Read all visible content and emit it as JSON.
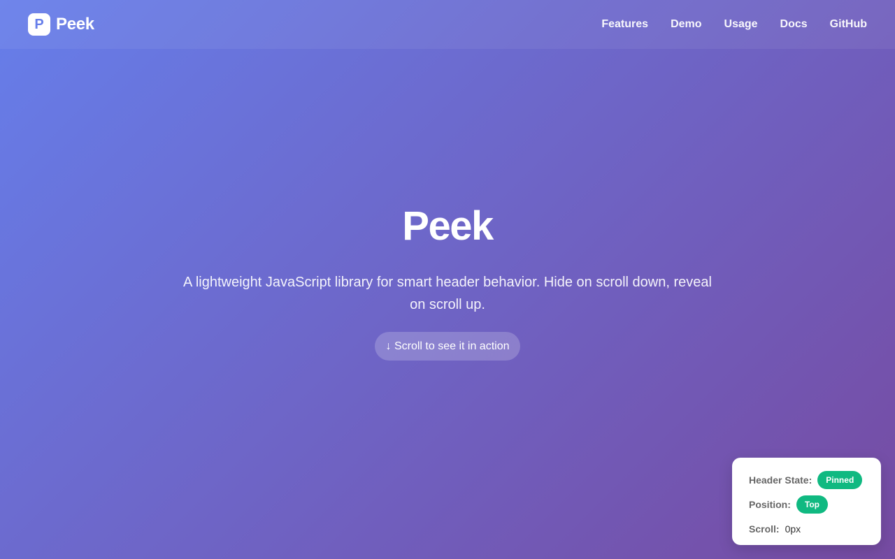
{
  "header": {
    "logo_letter": "P",
    "brand": "Peek",
    "nav": [
      {
        "label": "Features"
      },
      {
        "label": "Demo"
      },
      {
        "label": "Usage"
      },
      {
        "label": "Docs"
      },
      {
        "label": "GitHub"
      }
    ]
  },
  "hero": {
    "title": "Peek",
    "subtitle": "A lightweight JavaScript library for smart header behavior. Hide on scroll down, reveal on scroll up.",
    "cta": "↓ Scroll to see it in action"
  },
  "status": {
    "header_state_label": "Header State:",
    "header_state_value": "Pinned",
    "position_label": "Position:",
    "position_value": "Top",
    "scroll_label": "Scroll:",
    "scroll_value": "0px"
  },
  "colors": {
    "gradient_start": "#667eea",
    "gradient_end": "#764ba2",
    "badge": "#10b981"
  }
}
